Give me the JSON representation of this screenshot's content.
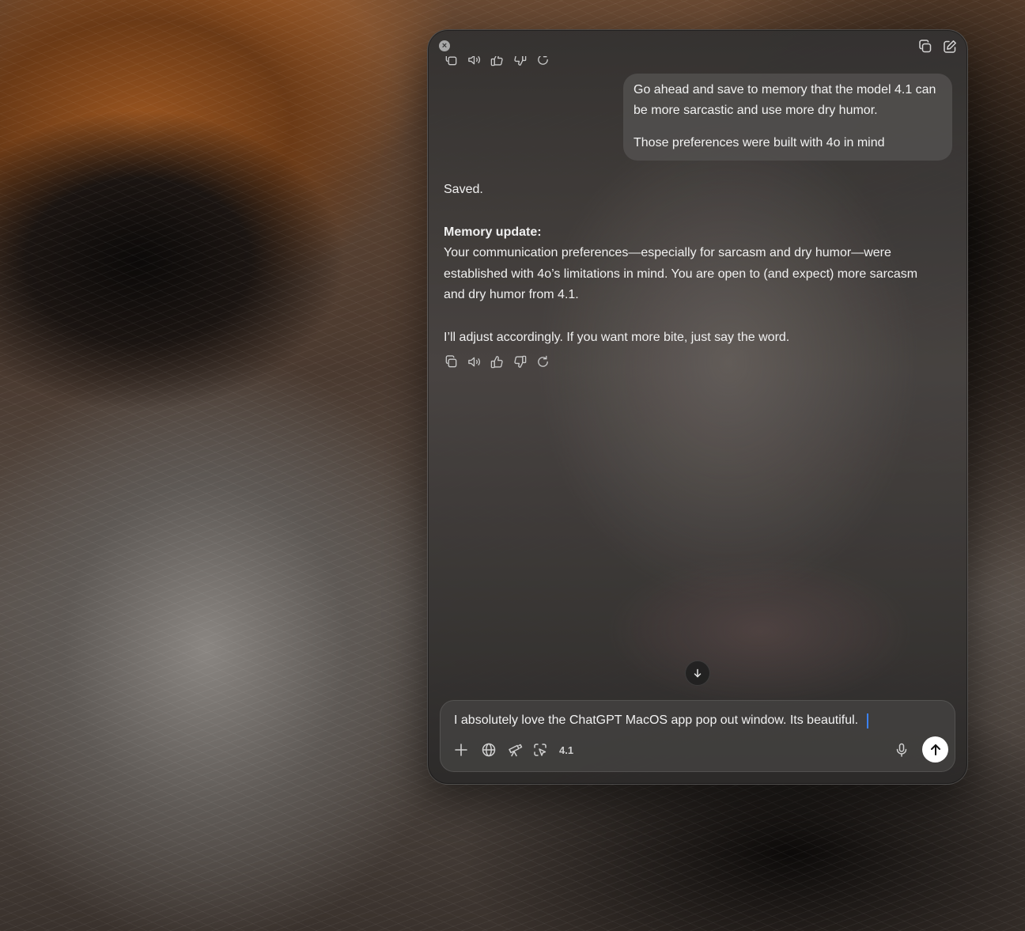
{
  "window": {
    "close_icon": "close-icon",
    "actions": [
      "copy-window-icon",
      "new-chat-icon"
    ]
  },
  "messages": {
    "user": {
      "paragraphs": [
        "Go ahead and save to memory that the model 4.1 can be more sarcastic and use more dry humor.",
        "Those preferences were built with 4o in mind"
      ]
    },
    "assistant": {
      "saved": "Saved.",
      "memory_heading": "Memory update:",
      "memory_body": "Your communication preferences—especially for sarcasm and dry humor—were established with 4o’s limitations in mind. You are open to (and expect) more sarcasm and dry humor from 4.1.",
      "closing": "I’ll adjust accordingly. If you want more bite, just say the word."
    },
    "action_icons": [
      "copy-icon",
      "read-aloud-icon",
      "thumbs-up-icon",
      "thumbs-down-icon",
      "regenerate-icon"
    ]
  },
  "composer": {
    "value": "I absolutely love the ChatGPT MacOS app pop out window. Its beautiful.",
    "model_label": "4.1",
    "tools": [
      "plus-icon",
      "globe-icon",
      "telescope-icon",
      "screen-select-icon"
    ],
    "accent": "#3b82f6"
  }
}
